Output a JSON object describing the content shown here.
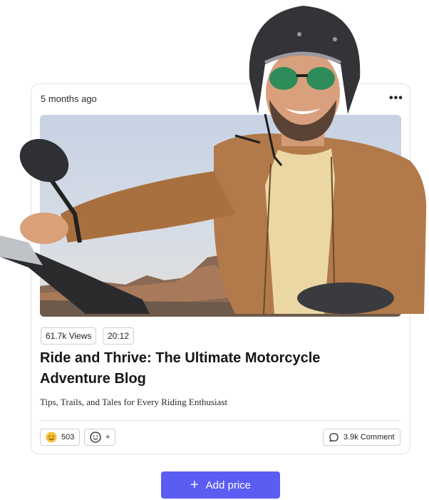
{
  "post": {
    "time_ago": "5 months ago",
    "more_icon": "more-horizontal-icon",
    "views": "61.7k Views",
    "duration": "20:12",
    "title": "Ride and Thrive: The Ultimate Motorcycle Adventure Blog",
    "subtitle": "Tips, Trails, and Tales for Every Riding Enthusiast"
  },
  "reactions": {
    "emoji": "smiley-face-icon",
    "emoji_count": "503",
    "add_icon": "add-reaction-icon",
    "add_label": "+"
  },
  "comments": {
    "icon": "comment-icon",
    "label": "3.9k Comment"
  },
  "cta": {
    "label": "Add price",
    "color": "#5b5cf2"
  },
  "colors": {
    "sky": "#b9c7dc",
    "jacket": "#b27a4a",
    "helmet": "#343438"
  }
}
